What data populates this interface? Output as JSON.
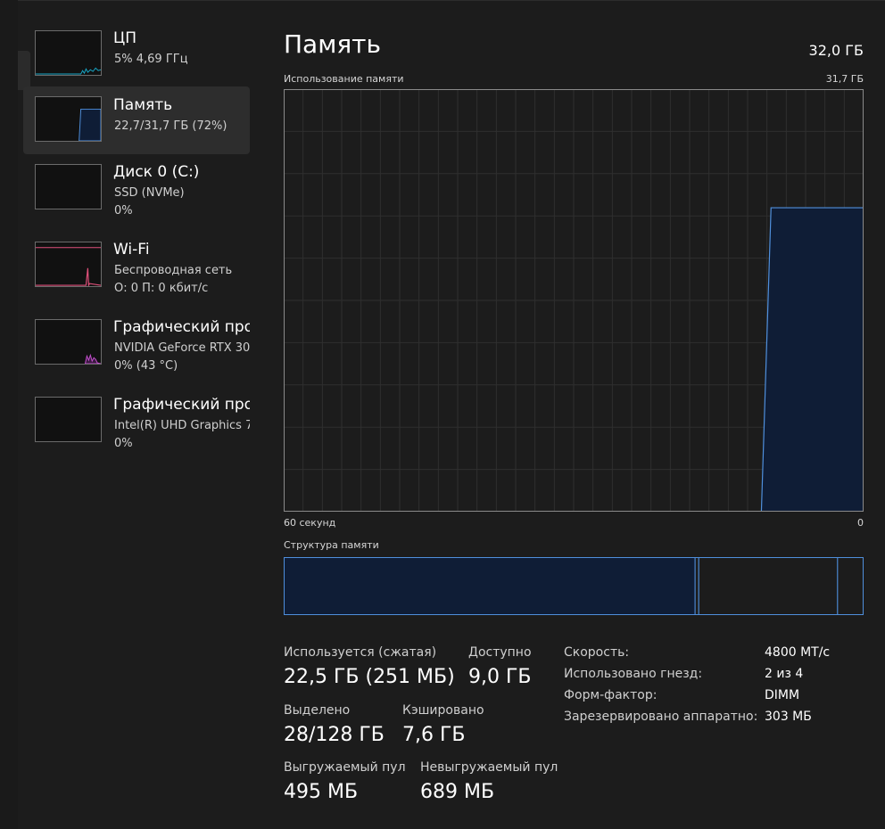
{
  "sidebar": {
    "items": [
      {
        "title": "ЦП",
        "line1": "5% 4,69 ГГц",
        "line2": ""
      },
      {
        "title": "Память",
        "line1": "22,7/31,7 ГБ (72%)",
        "line2": ""
      },
      {
        "title": "Диск 0 (C:)",
        "line1": "SSD (NVMe)",
        "line2": "0%"
      },
      {
        "title": "Wi-Fi",
        "line1": "Беспроводная сеть",
        "line2": "О: 0 П: 0 кбит/с"
      },
      {
        "title": "Графический про",
        "line1": "NVIDIA GeForce RTX 30",
        "line2": "0% (43 °C)"
      },
      {
        "title": "Графический про",
        "line1": "Intel(R) UHD Graphics 7",
        "line2": "0%"
      }
    ],
    "selected_index": 1
  },
  "main": {
    "title": "Память",
    "total": "32,0 ГБ",
    "usage_label": "Использование памяти",
    "usage_max": "31,7 ГБ",
    "time_left": "60 секунд",
    "time_right": "0",
    "structure_label": "Структура памяти"
  },
  "stats": {
    "in_use_label": "Используется (сжатая)",
    "in_use_value": "22,5 ГБ (251 МБ)",
    "available_label": "Доступно",
    "available_value": "9,0 ГБ",
    "committed_label": "Выделено",
    "committed_value": "28/128 ГБ",
    "cached_label": "Кэшировано",
    "cached_value": "7,6 ГБ",
    "paged_label": "Выгружаемый пул",
    "paged_value": "495 МБ",
    "nonpaged_label": "Невыгружаемый пул",
    "nonpaged_value": "689 МБ"
  },
  "specs": [
    {
      "label": "Скорость:",
      "value": "4800 МТ/с"
    },
    {
      "label": "Использовано гнезд:",
      "value": "2 из 4"
    },
    {
      "label": "Форм-фактор:",
      "value": "DIMM"
    },
    {
      "label": "Зарезервировано аппаратно:",
      "value": "303 МБ"
    }
  ],
  "colors": {
    "accent": "#4f8fdc",
    "fill": "#0f1d36",
    "grid": "#2f2f2f",
    "cpu_line": "#17a8c8",
    "wifi_line": "#e0507a",
    "gpu_line": "#c64fd0"
  },
  "chart_data": {
    "type": "area",
    "title": "Использование памяти",
    "ylim": [
      0,
      31.7
    ],
    "xlim": [
      60,
      0
    ],
    "x_seconds_ago": [
      60,
      10.5,
      9.5,
      8,
      6,
      4,
      2,
      0
    ],
    "y_gb": [
      0,
      0,
      22.8,
      22.8,
      22.8,
      22.8,
      22.8,
      22.8
    ],
    "grid": true,
    "structure": {
      "in_use_gb": 22.5,
      "modified_gb": 0.2,
      "standby_gb": 7.6,
      "free_gb": 1.4
    }
  }
}
